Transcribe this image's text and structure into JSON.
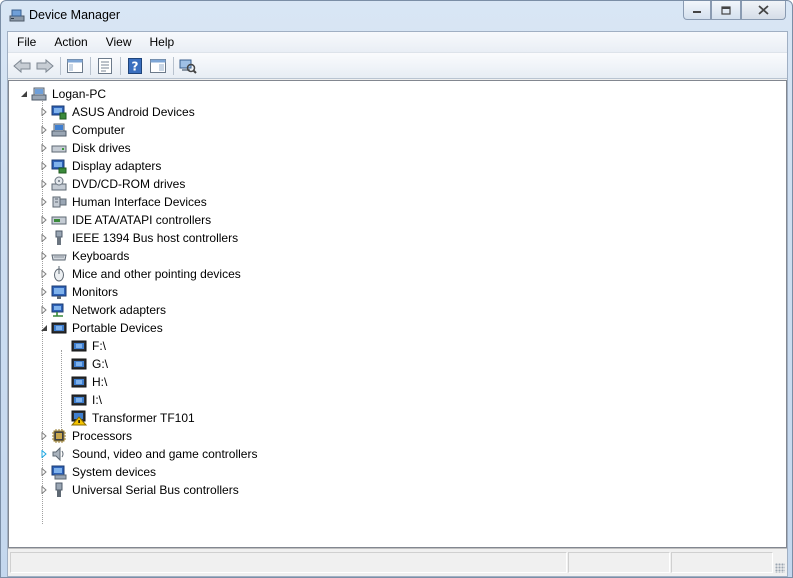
{
  "window": {
    "title": "Device Manager"
  },
  "menu": [
    "File",
    "Action",
    "View",
    "Help"
  ],
  "toolbar": [
    "back-icon",
    "forward-icon",
    "show-hide-console-tree-icon",
    "properties-icon",
    "help-icon",
    "action-pane-icon",
    "scan-hardware-icon"
  ],
  "tree": {
    "root": {
      "label": "Logan-PC",
      "icon": "computer-icon",
      "expanded": true
    },
    "categories": [
      {
        "label": "ASUS Android Devices",
        "icon": "android-device-icon"
      },
      {
        "label": "Computer",
        "icon": "computer-icon"
      },
      {
        "label": "Disk drives",
        "icon": "disk-drive-icon"
      },
      {
        "label": "Display adapters",
        "icon": "display-adapter-icon"
      },
      {
        "label": "DVD/CD-ROM drives",
        "icon": "dvd-drive-icon"
      },
      {
        "label": "Human Interface Devices",
        "icon": "hid-icon"
      },
      {
        "label": "IDE ATA/ATAPI controllers",
        "icon": "ide-controller-icon"
      },
      {
        "label": "IEEE 1394 Bus host controllers",
        "icon": "firewire-icon"
      },
      {
        "label": "Keyboards",
        "icon": "keyboard-icon"
      },
      {
        "label": "Mice and other pointing devices",
        "icon": "mouse-icon"
      },
      {
        "label": "Monitors",
        "icon": "monitor-icon"
      },
      {
        "label": "Network adapters",
        "icon": "network-adapter-icon"
      },
      {
        "label": "Portable Devices",
        "icon": "portable-device-icon",
        "expanded": true,
        "children": [
          {
            "label": "F:\\",
            "icon": "portable-device-icon"
          },
          {
            "label": "G:\\",
            "icon": "portable-device-icon"
          },
          {
            "label": "H:\\",
            "icon": "portable-device-icon"
          },
          {
            "label": "I:\\",
            "icon": "portable-device-icon"
          },
          {
            "label": "Transformer TF101",
            "icon": "warning-device-icon"
          }
        ]
      },
      {
        "label": "Processors",
        "icon": "processor-icon"
      },
      {
        "label": "Sound, video and game controllers",
        "icon": "speaker-icon"
      },
      {
        "label": "System devices",
        "icon": "system-device-icon"
      },
      {
        "label": "Universal Serial Bus controllers",
        "icon": "usb-icon"
      }
    ]
  },
  "colors": {
    "selection_hover": "#1ea7e1",
    "warning": "#f5c400"
  }
}
